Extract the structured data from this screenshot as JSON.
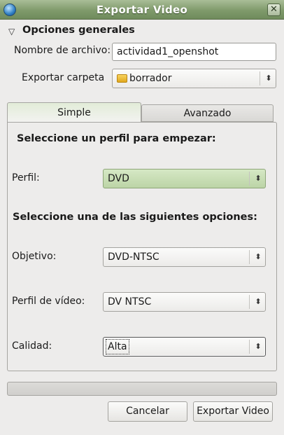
{
  "window": {
    "title": "Exportar Video",
    "close_glyph": "✕"
  },
  "section": {
    "arrow": "▽",
    "title": "Opciones generales"
  },
  "general": {
    "filename_label": "Nombre de archivo:",
    "filename_value": "actividad1_openshot",
    "folder_label": "Exportar carpeta",
    "folder_value": "borrador"
  },
  "tabs": [
    {
      "label": "Simple",
      "selected": true
    },
    {
      "label": "Avanzado",
      "selected": false
    }
  ],
  "simple": {
    "profile_heading": "Seleccione un perfil para empezar:",
    "perfil_label": "Perfil:",
    "perfil_value": "DVD",
    "options_heading": "Seleccione una de las siguientes opciones:",
    "objetivo_label": "Objetivo:",
    "objetivo_value": "DVD-NTSC",
    "perfil_video_label": "Perfil de vídeo:",
    "perfil_video_value": "DV NTSC",
    "calidad_label": "Calidad:",
    "calidad_value": "Alta"
  },
  "progress": {
    "fraction": 0
  },
  "buttons": {
    "cancel": "Cancelar",
    "export": "Exportar Video"
  },
  "icons": {
    "spin": "⬍",
    "app": "openshot-icon",
    "folder": "folder-icon"
  },
  "colors": {
    "titlebar": "#7f9a6b",
    "selected_combo": "#c9ddb5"
  }
}
